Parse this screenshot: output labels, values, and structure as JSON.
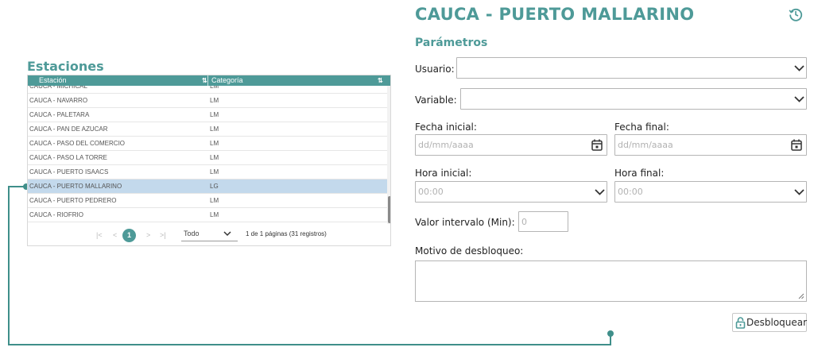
{
  "accent_color": "#4e9a98",
  "left_panel": {
    "title": "Estaciones",
    "columns": [
      "Estación",
      "Categoría"
    ],
    "sort_icon": "sort-icon",
    "rows": [
      {
        "station": "CAUCA - MICHICAL",
        "category": "LM"
      },
      {
        "station": "CAUCA - NAVARRO",
        "category": "LM"
      },
      {
        "station": "CAUCA - PALETARA",
        "category": "LM"
      },
      {
        "station": "CAUCA - PAN DE AZUCAR",
        "category": "LM"
      },
      {
        "station": "CAUCA - PASO DEL COMERCIO",
        "category": "LM"
      },
      {
        "station": "CAUCA - PASO LA TORRE",
        "category": "LM"
      },
      {
        "station": "CAUCA - PUERTO ISAACS",
        "category": "LM"
      },
      {
        "station": "CAUCA - PUERTO MALLARINO",
        "category": "LG"
      },
      {
        "station": "CAUCA - PUERTO PEDRERO",
        "category": "LM"
      },
      {
        "station": "CAUCA - RIOFRIO",
        "category": "LM"
      }
    ],
    "selected_row_index": 7,
    "pager": {
      "first": "|<",
      "prev": "<",
      "current_page": "1",
      "next": ">",
      "last": ">|",
      "page_size": "Todo",
      "info": "1 de 1 páginas (31 registros)"
    }
  },
  "right_panel": {
    "title": "CAUCA - PUERTO MALLARINO",
    "history_icon": "history-icon",
    "params_title": "Parámetros",
    "usuario_label": "Usuario:",
    "usuario_value": "",
    "variable_label": "Variable:",
    "variable_value": "",
    "fecha_inicial_label": "Fecha inicial:",
    "fecha_inicial_placeholder": "dd/mm/aaaa",
    "fecha_final_label": "Fecha final:",
    "fecha_final_placeholder": "dd/mm/aaaa",
    "hora_inicial_label": "Hora inicial:",
    "hora_inicial_value": "00:00",
    "hora_final_label": "Hora final:",
    "hora_final_value": "00:00",
    "valor_intervalo_label": "Valor intervalo (Min):",
    "valor_intervalo_placeholder": "0",
    "motivo_label": "Motivo de desbloqueo:",
    "motivo_value": "",
    "unlock_button": "Desbloquear",
    "unlock_icon": "unlock-icon"
  }
}
